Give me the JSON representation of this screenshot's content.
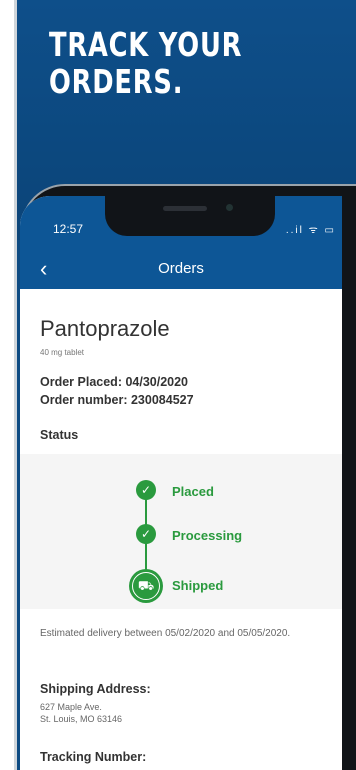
{
  "promo": {
    "headline_line1": "TRACK YOUR",
    "headline_line2": "ORDERS."
  },
  "status_bar": {
    "time": "12:57",
    "icons": "..il ᯤ ▭"
  },
  "app_bar": {
    "title": "Orders"
  },
  "order": {
    "drug_name": "Pantoprazole",
    "dose": "40 mg tablet",
    "order_placed": "Order Placed: 04/30/2020",
    "order_number": "Order number: 230084527",
    "status_label": "Status",
    "status_steps": [
      {
        "label": "Placed",
        "done": true,
        "icon": "check-icon"
      },
      {
        "label": "Processing",
        "done": true,
        "icon": "check-icon"
      },
      {
        "label": "Shipped",
        "done": true,
        "current": true,
        "icon": "truck-icon"
      }
    ],
    "estimated_delivery": "Estimated delivery between 05/02/2020 and 05/05/2020.",
    "shipping_address_label": "Shipping Address:",
    "address_line1": "627 Maple Ave.",
    "address_line2": "St. Louis, MO 63146",
    "tracking_label": "Tracking Number:"
  },
  "colors": {
    "brand_blue": "#0d5696",
    "promo_bg": "#0c4a82",
    "status_green": "#2a9a3e"
  }
}
